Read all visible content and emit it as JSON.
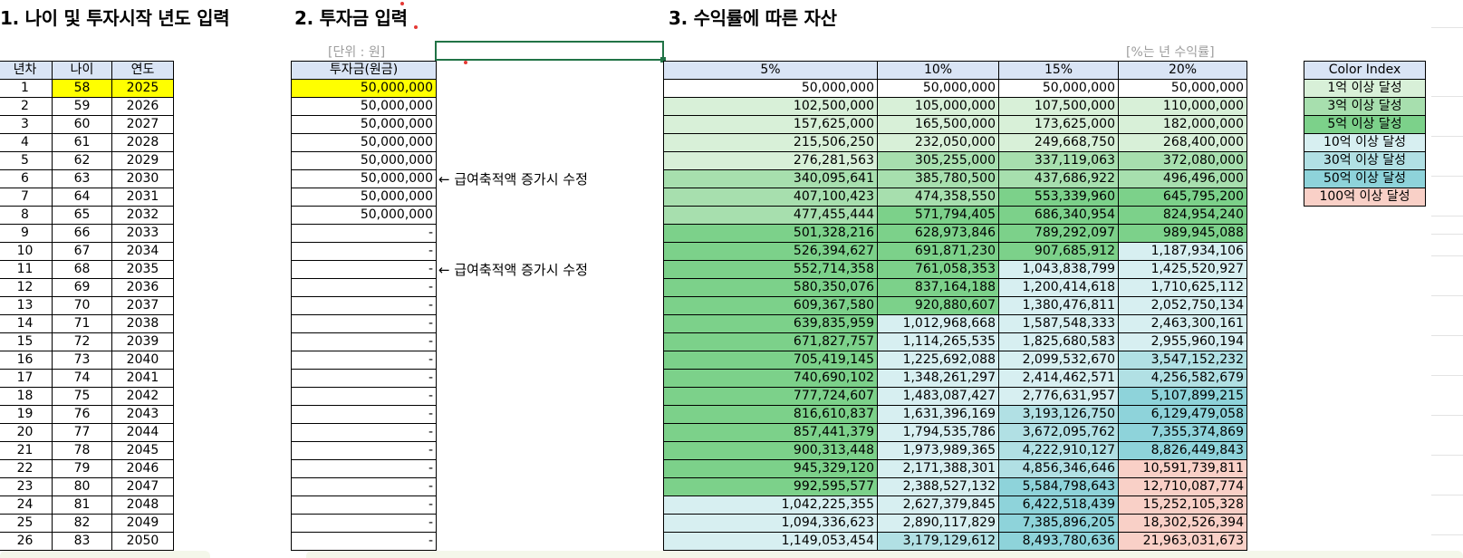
{
  "sections": {
    "s1": "1. 나이 및 투자시작 년도 입력",
    "s2": "2. 투자금 입력",
    "s3": "3. 수익률에 따른 자산"
  },
  "unit_label": "[단위 : 원]",
  "rate_note": "[%는 년 수익률]",
  "age_table": {
    "headers": [
      "년차",
      "나이",
      "연도"
    ],
    "rows": [
      [
        "1",
        "58",
        "2025"
      ],
      [
        "2",
        "59",
        "2026"
      ],
      [
        "3",
        "60",
        "2027"
      ],
      [
        "4",
        "61",
        "2028"
      ],
      [
        "5",
        "62",
        "2029"
      ],
      [
        "6",
        "63",
        "2030"
      ],
      [
        "7",
        "64",
        "2031"
      ],
      [
        "8",
        "65",
        "2032"
      ],
      [
        "9",
        "66",
        "2033"
      ],
      [
        "10",
        "67",
        "2034"
      ],
      [
        "11",
        "68",
        "2035"
      ],
      [
        "12",
        "69",
        "2036"
      ],
      [
        "13",
        "70",
        "2037"
      ],
      [
        "14",
        "71",
        "2038"
      ],
      [
        "15",
        "72",
        "2039"
      ],
      [
        "16",
        "73",
        "2040"
      ],
      [
        "17",
        "74",
        "2041"
      ],
      [
        "18",
        "75",
        "2042"
      ],
      [
        "19",
        "76",
        "2043"
      ],
      [
        "20",
        "77",
        "2044"
      ],
      [
        "21",
        "78",
        "2045"
      ],
      [
        "22",
        "79",
        "2046"
      ],
      [
        "23",
        "80",
        "2047"
      ],
      [
        "24",
        "81",
        "2048"
      ],
      [
        "25",
        "82",
        "2049"
      ],
      [
        "26",
        "83",
        "2050"
      ]
    ]
  },
  "invest_table": {
    "header": "투자금(원금)",
    "values": [
      "50,000,000",
      "50,000,000",
      "50,000,000",
      "50,000,000",
      "50,000,000",
      "50,000,000",
      "50,000,000",
      "50,000,000",
      "-",
      "-",
      "-",
      "-",
      "-",
      "-",
      "-",
      "-",
      "-",
      "-",
      "-",
      "-",
      "-",
      "-",
      "-",
      "-",
      "-",
      "-"
    ]
  },
  "notes": [
    "← 급여축적액 증가시 수정",
    "← 급여축적액 증가시 수정"
  ],
  "asset_table": {
    "headers": [
      "5%",
      "10%",
      "15%",
      "20%"
    ],
    "rows": [
      [
        "50,000,000",
        "50,000,000",
        "50,000,000",
        "50,000,000"
      ],
      [
        "102,500,000",
        "105,000,000",
        "107,500,000",
        "110,000,000"
      ],
      [
        "157,625,000",
        "165,500,000",
        "173,625,000",
        "182,000,000"
      ],
      [
        "215,506,250",
        "232,050,000",
        "249,668,750",
        "268,400,000"
      ],
      [
        "276,281,563",
        "305,255,000",
        "337,119,063",
        "372,080,000"
      ],
      [
        "340,095,641",
        "385,780,500",
        "437,686,922",
        "496,496,000"
      ],
      [
        "407,100,423",
        "474,358,550",
        "553,339,960",
        "645,795,200"
      ],
      [
        "477,455,444",
        "571,794,405",
        "686,340,954",
        "824,954,240"
      ],
      [
        "501,328,216",
        "628,973,846",
        "789,292,097",
        "989,945,088"
      ],
      [
        "526,394,627",
        "691,871,230",
        "907,685,912",
        "1,187,934,106"
      ],
      [
        "552,714,358",
        "761,058,353",
        "1,043,838,799",
        "1,425,520,927"
      ],
      [
        "580,350,076",
        "837,164,188",
        "1,200,414,618",
        "1,710,625,112"
      ],
      [
        "609,367,580",
        "920,880,607",
        "1,380,476,811",
        "2,052,750,134"
      ],
      [
        "639,835,959",
        "1,012,968,668",
        "1,587,548,333",
        "2,463,300,161"
      ],
      [
        "671,827,757",
        "1,114,265,535",
        "1,825,680,583",
        "2,955,960,194"
      ],
      [
        "705,419,145",
        "1,225,692,088",
        "2,099,532,670",
        "3,547,152,232"
      ],
      [
        "740,690,102",
        "1,348,261,297",
        "2,414,462,571",
        "4,256,582,679"
      ],
      [
        "777,724,607",
        "1,483,087,427",
        "2,776,631,957",
        "5,107,899,215"
      ],
      [
        "816,610,837",
        "1,631,396,169",
        "3,193,126,750",
        "6,129,479,058"
      ],
      [
        "857,441,379",
        "1,794,535,786",
        "3,672,095,762",
        "7,355,374,869"
      ],
      [
        "900,313,448",
        "1,973,989,365",
        "4,222,910,127",
        "8,826,449,843"
      ],
      [
        "945,329,120",
        "2,171,388,301",
        "4,856,346,646",
        "10,591,739,811"
      ],
      [
        "992,595,577",
        "2,388,527,132",
        "5,584,798,643",
        "12,710,087,774"
      ],
      [
        "1,042,225,355",
        "2,627,379,845",
        "6,422,518,439",
        "15,252,105,328"
      ],
      [
        "1,094,336,623",
        "2,890,117,829",
        "7,385,896,205",
        "18,302,526,394"
      ],
      [
        "1,149,053,454",
        "3,179,129,612",
        "8,493,780,636",
        "21,963,031,673"
      ]
    ]
  },
  "color_index": {
    "header": "Color Index",
    "items": [
      {
        "label": "1억 이상 달성",
        "color": "#d8f0d8"
      },
      {
        "label": "3억 이상 달성",
        "color": "#a7dfae"
      },
      {
        "label": "5억 이상 달성",
        "color": "#7cd18a"
      },
      {
        "label": "10억 이상 달성",
        "color": "#d7eff1"
      },
      {
        "label": "30억 이상 달성",
        "color": "#b1e0e4"
      },
      {
        "label": "50억 이상 달성",
        "color": "#8ed3da"
      },
      {
        "label": "100억 이상 달성",
        "color": "#f9d0c7"
      }
    ]
  },
  "colors": {
    "highlight_yellow": "#ffff00",
    "header_blue": "#d9e4f5",
    "selection_green": "#217346"
  }
}
